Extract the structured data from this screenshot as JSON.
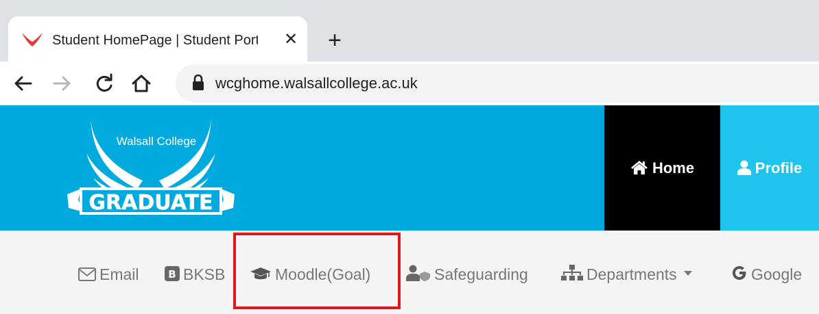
{
  "browser": {
    "tab_title": "Student HomePage | Student Portal",
    "close_glyph": "✕",
    "new_tab_glyph": "+",
    "url": "wcghome.walsallcollege.ac.uk"
  },
  "logo": {
    "college_name": "Walsall College",
    "banner_text": "GRADUATE"
  },
  "main_nav": {
    "home_label": "Home",
    "profile_label": "Profile"
  },
  "sub_nav": {
    "items": [
      {
        "label": "Email",
        "icon": "envelope-icon"
      },
      {
        "label": "BKSB",
        "icon": "bksb-b-icon"
      },
      {
        "label": "Moodle(Goal)",
        "icon": "graduation-cap-icon"
      },
      {
        "label": "Safeguarding",
        "icon": "user-shield-icon"
      },
      {
        "label": "Departments",
        "icon": "sitemap-icon"
      },
      {
        "label": "Google",
        "icon": "google-g-icon"
      }
    ]
  },
  "colors": {
    "header_blue": "#00aade",
    "profile_blue": "#1ec4ee",
    "active_nav": "#000000",
    "subnav_text": "#777777",
    "annotation_red": "#e0171e"
  }
}
